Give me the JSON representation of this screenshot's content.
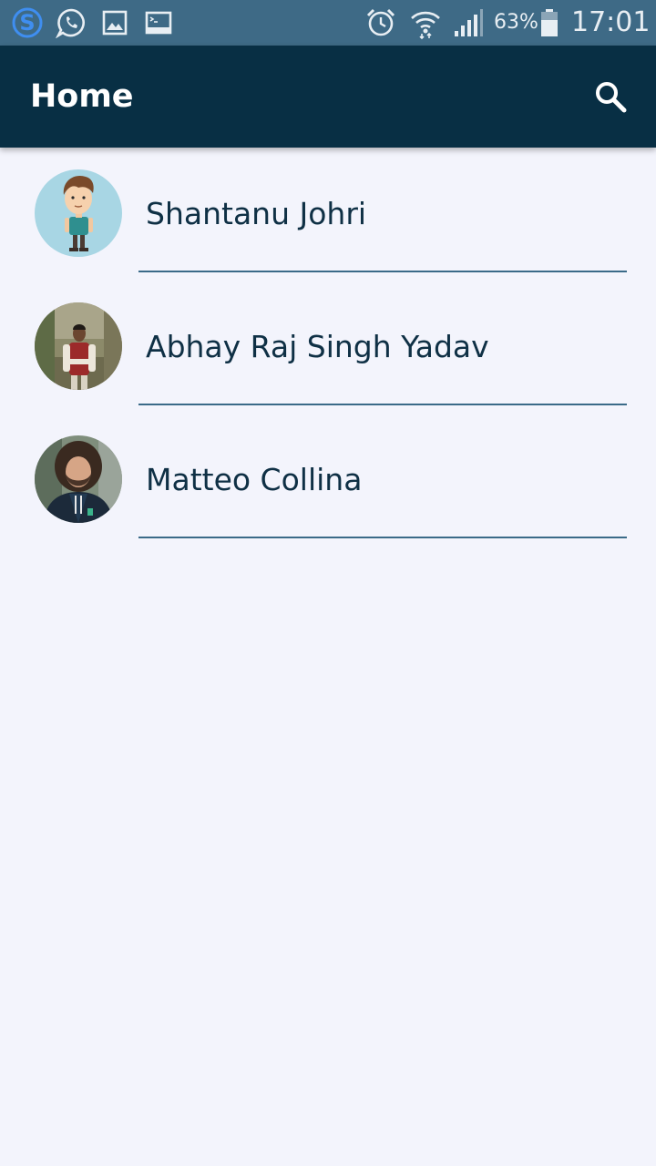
{
  "status_bar": {
    "battery_percent": "63%",
    "time": "17:01",
    "left_icons": [
      "skype-icon",
      "whatsapp-icon",
      "gallery-icon",
      "terminal-icon"
    ],
    "right_icons": [
      "alarm-icon",
      "wifi-icon",
      "signal-icon",
      "battery-icon"
    ],
    "bg_color": "#3e6a86"
  },
  "app_bar": {
    "title": "Home",
    "search_icon": "search-icon",
    "bg_color": "#082f44"
  },
  "contacts": [
    {
      "name": "Shantanu Johri",
      "avatar": "cartoon-avatar"
    },
    {
      "name": "Abhay Raj Singh Yadav",
      "avatar": "photo-avatar"
    },
    {
      "name": "Matteo Collina",
      "avatar": "photo-avatar"
    }
  ],
  "colors": {
    "background": "#f3f4fc",
    "name_text": "#0f3045",
    "divider": "#3a6a88"
  }
}
